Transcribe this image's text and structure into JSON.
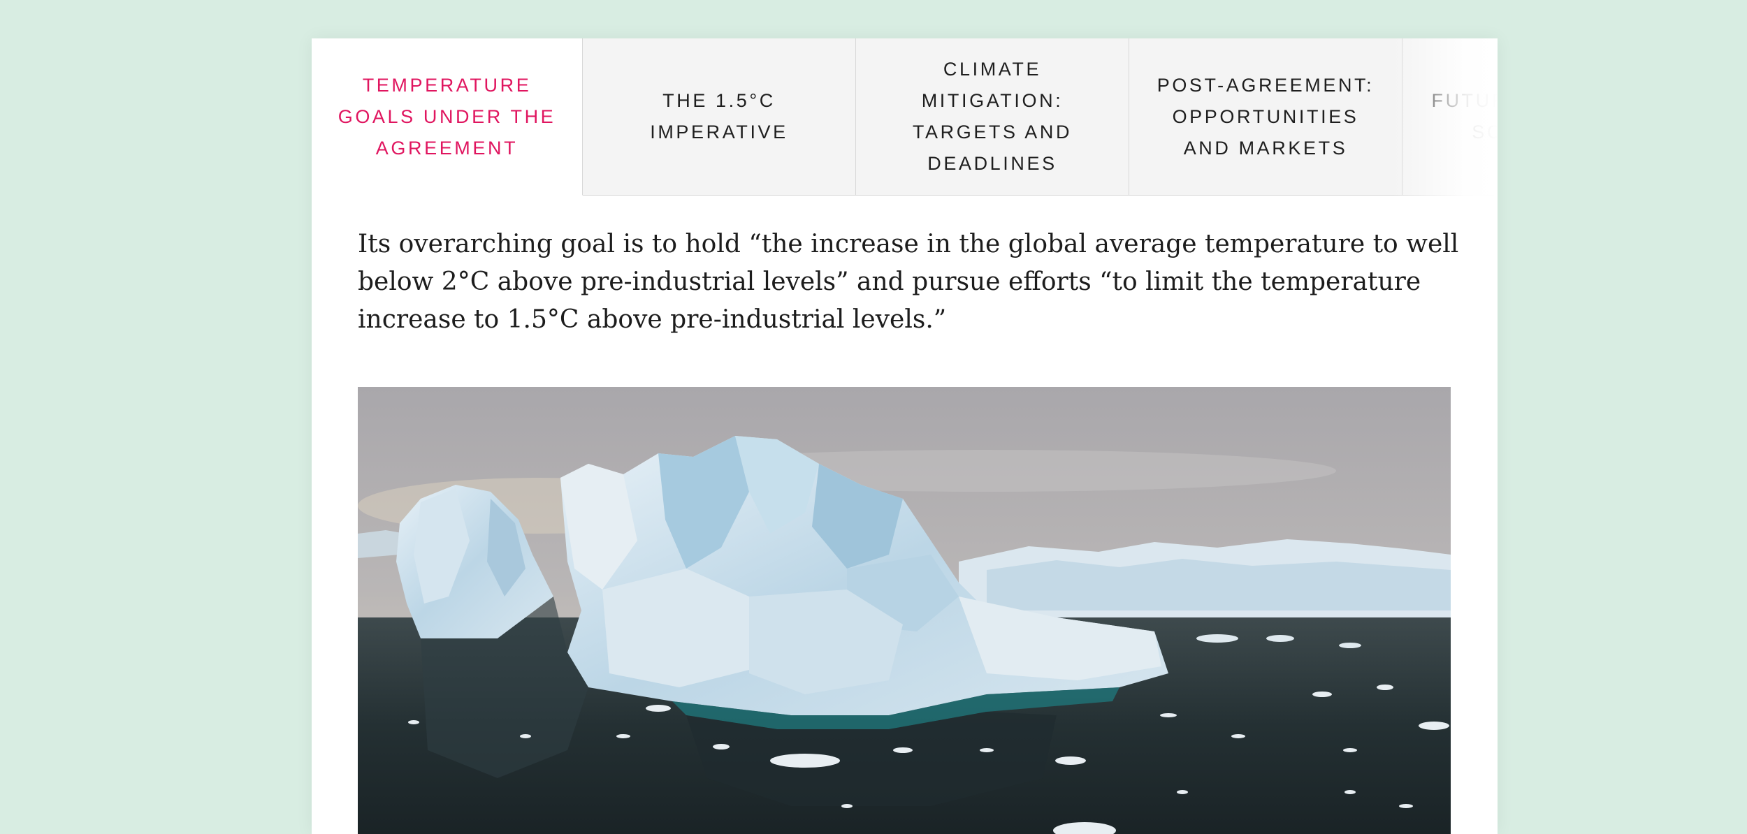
{
  "tabs": [
    {
      "label": "Temperature goals under the agreement",
      "active": true
    },
    {
      "label": "The 1.5°C imperative",
      "active": false
    },
    {
      "label": "Climate mitigation: targets and deadlines",
      "active": false
    },
    {
      "label": "Post-agreement: opportunities and markets",
      "active": false
    },
    {
      "label": "Future net zero scenarios",
      "active": false
    }
  ],
  "article": {
    "quote": "Its overarching goal is to hold “the increase in the global average temperature to well below 2°C above pre-industrial levels” and pursue efforts “to limit the temperature increase to 1.5°C above pre-industrial levels.”"
  },
  "image": {
    "subject": "iceberg-photo"
  },
  "colors": {
    "page_background": "#d8ede2",
    "card_background": "#ffffff",
    "active_tab": "#e0155f",
    "inactive_tab_bg": "#f4f4f4",
    "tab_text": "#1e1e1e"
  }
}
